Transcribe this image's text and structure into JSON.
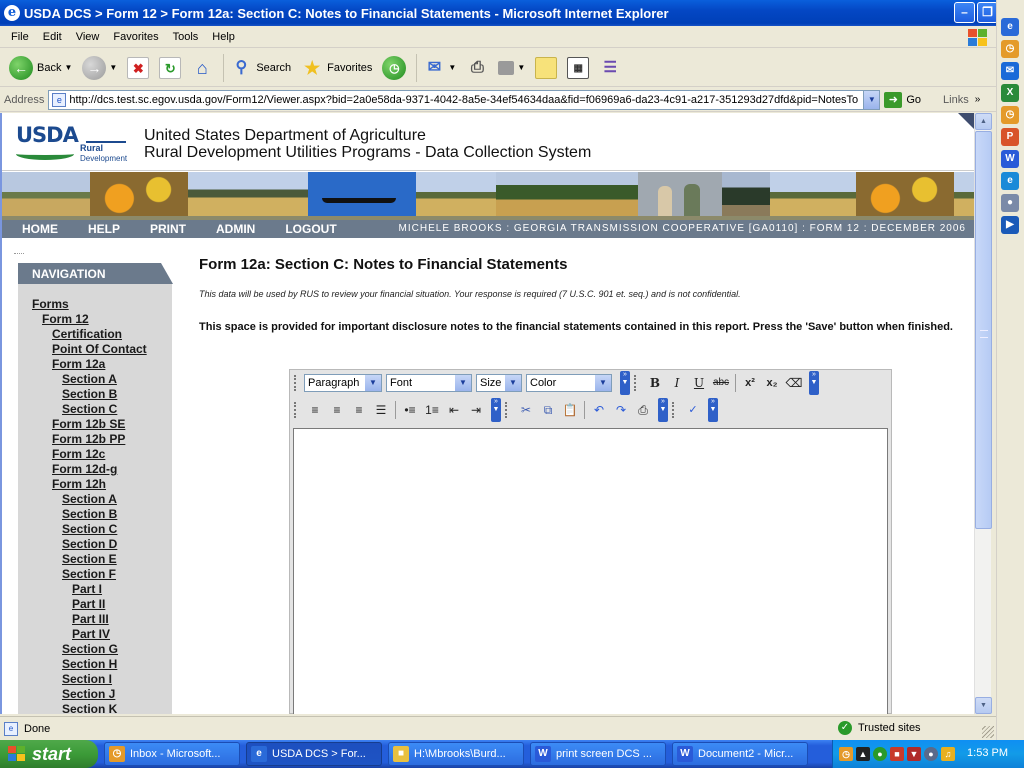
{
  "window": {
    "title": "USDA DCS > Form 12 > Form 12a: Section C: Notes to Financial Statements - Microsoft Internet Explorer"
  },
  "menu": [
    "File",
    "Edit",
    "View",
    "Favorites",
    "Tools",
    "Help"
  ],
  "toolbar": {
    "back_label": "Back",
    "search_label": "Search",
    "favorites_label": "Favorites"
  },
  "address": {
    "label": "Address",
    "url": "http://dcs.test.sc.egov.usda.gov/Form12/Viewer.aspx?bid=2a0e58da-9371-4042-8a5e-34ef54634daa&fid=f06969a6-da23-4c91-a217-351293d27dfd&pid=NotesTo",
    "go_label": "Go",
    "links_label": "Links"
  },
  "header": {
    "usda_logo_text": "USDA",
    "rd_logo_line1": "Rural",
    "rd_logo_line2": "Development",
    "line1": "United States Department of Agriculture",
    "line2": "Rural Development Utilities Programs - Data Collection System"
  },
  "nav": {
    "links": [
      "HOME",
      "HELP",
      "PRINT",
      "ADMIN",
      "LOGOUT"
    ],
    "info": "MICHELE BROOKS : GEORGIA TRANSMISSION COOPERATIVE [GA0110] : FORM 12 : DECEMBER 2006"
  },
  "leftnav": {
    "title": "NAVIGATION",
    "items": [
      {
        "label": "Forms",
        "level": 0
      },
      {
        "label": "Form 12",
        "level": 1
      },
      {
        "label": "Certification",
        "level": 2
      },
      {
        "label": "Point Of Contact",
        "level": 2
      },
      {
        "label": "Form 12a",
        "level": 2
      },
      {
        "label": "Section A",
        "level": 3
      },
      {
        "label": "Section B",
        "level": 3
      },
      {
        "label": "Section C",
        "level": 3
      },
      {
        "label": "Form 12b SE",
        "level": 2
      },
      {
        "label": "Form 12b PP",
        "level": 2
      },
      {
        "label": "Form 12c",
        "level": 2
      },
      {
        "label": "Form 12d-g",
        "level": 2
      },
      {
        "label": "Form 12h",
        "level": 2
      },
      {
        "label": "Section A",
        "level": 3
      },
      {
        "label": "Section B",
        "level": 3
      },
      {
        "label": "Section C",
        "level": 3
      },
      {
        "label": "Section D",
        "level": 3
      },
      {
        "label": "Section E",
        "level": 3
      },
      {
        "label": "Section F",
        "level": 3
      },
      {
        "label": "Part I",
        "level": 4
      },
      {
        "label": "Part II",
        "level": 4
      },
      {
        "label": "Part III",
        "level": 4
      },
      {
        "label": "Part IV",
        "level": 4
      },
      {
        "label": "Section G",
        "level": 3
      },
      {
        "label": "Section H",
        "level": 3
      },
      {
        "label": "Section I",
        "level": 3
      },
      {
        "label": "Section J",
        "level": 3
      },
      {
        "label": "Section K",
        "level": 3
      }
    ]
  },
  "main": {
    "title": "Form 12a: Section C: Notes to Financial Statements",
    "note": "This data will be used by RUS to review your financial situation. Your response is required (7 U.S.C. 901 et. seq.) and is not confidential.",
    "instructions": "This space is provided for important disclosure notes to the financial statements contained in this report. Press the 'Save' button when finished."
  },
  "editor": {
    "paragraph": "Paragraph",
    "font": "Font",
    "size": "Size",
    "color": "Color"
  },
  "status": {
    "text": "Done",
    "zone": "Trusted sites"
  },
  "taskbar": {
    "start": "start",
    "tasks": [
      {
        "label": "Inbox - Microsoft...",
        "icon": "outlook-icon"
      },
      {
        "label": "USDA DCS > For...",
        "icon": "ie-icon"
      },
      {
        "label": "H:\\Mbrooks\\Burd...",
        "icon": "folder-icon"
      },
      {
        "label": "print screen DCS ...",
        "icon": "word-icon"
      },
      {
        "label": "Document2 - Micr...",
        "icon": "word-icon"
      }
    ],
    "time": "1:53 PM"
  }
}
